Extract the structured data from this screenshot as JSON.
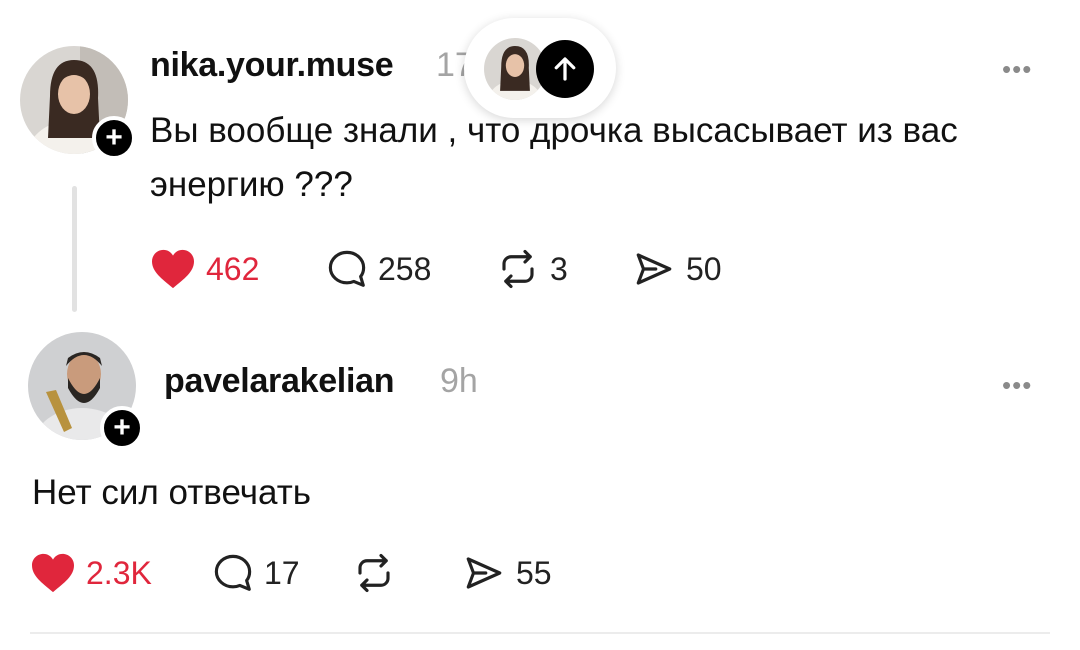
{
  "posts": [
    {
      "username": "nika.your.muse",
      "time": "17",
      "text_lines": [
        "Вы вообще знали , что дрочка высасывает из вас",
        "энергию ???"
      ],
      "likes": "462",
      "comments": "258",
      "reposts": "3",
      "shares": "50",
      "liked": true
    },
    {
      "username": "pavelarakelian",
      "time": "9h",
      "text": "Нет сил отвечать",
      "likes": "2.3K",
      "comments": "17",
      "reposts": "",
      "shares": "55",
      "liked": true
    }
  ],
  "icons": {
    "like": "heart-icon",
    "comment": "comment-bubble-icon",
    "repost": "repost-icon",
    "share": "share-send-icon",
    "more": "more-dots-icon",
    "follow": "plus-icon",
    "scroll_up": "arrow-up-icon"
  },
  "colors": {
    "like_red": "#e0263c",
    "text": "#111111",
    "muted": "#a4a4a4"
  }
}
